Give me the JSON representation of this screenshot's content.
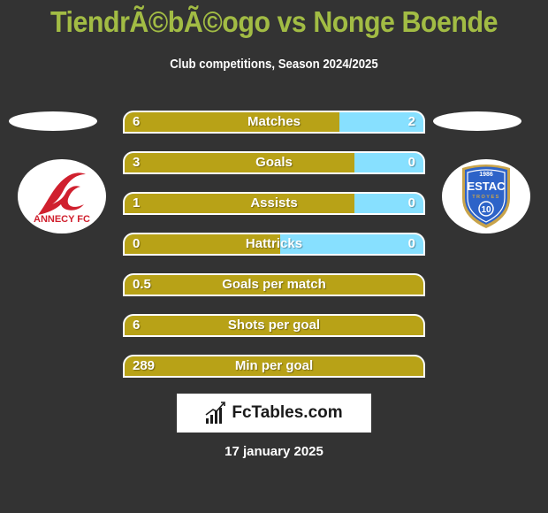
{
  "header": {
    "title": "TiendrÃ©bÃ©ogo vs Nonge Boende",
    "subtitle": "Club competitions, Season 2024/2025"
  },
  "teams": {
    "left": {
      "name": "Annecy FC",
      "logo_text": "ANNECY FC",
      "logo_icon": "annecy-fc-logo"
    },
    "right": {
      "name": "ESTAC Troyes",
      "logo_text": "ESTAC",
      "logo_subtext": "TROYES",
      "logo_year": "1986",
      "logo_number": "10",
      "logo_icon": "estac-troyes-logo"
    }
  },
  "colors": {
    "left_bar": "#b8a217",
    "right_bar": "#87e0ff",
    "title": "#a2bc44",
    "background": "#333333"
  },
  "stats": [
    {
      "label": "Matches",
      "left": "6",
      "right": "2",
      "left_share_percent": 72
    },
    {
      "label": "Goals",
      "left": "3",
      "right": "0",
      "left_share_percent": 77
    },
    {
      "label": "Assists",
      "left": "1",
      "right": "0",
      "left_share_percent": 77
    },
    {
      "label": "Hattricks",
      "left": "0",
      "right": "0",
      "left_share_percent": 52
    },
    {
      "label": "Goals per match",
      "left": "0.5",
      "right": "",
      "left_share_percent": 100
    },
    {
      "label": "Shots per goal",
      "left": "6",
      "right": "",
      "left_share_percent": 100
    },
    {
      "label": "Min per goal",
      "left": "289",
      "right": "",
      "left_share_percent": 100
    }
  ],
  "footer": {
    "brand": "FcTables.com",
    "brand_icon": "bar-chart-icon",
    "date": "17 january 2025"
  }
}
